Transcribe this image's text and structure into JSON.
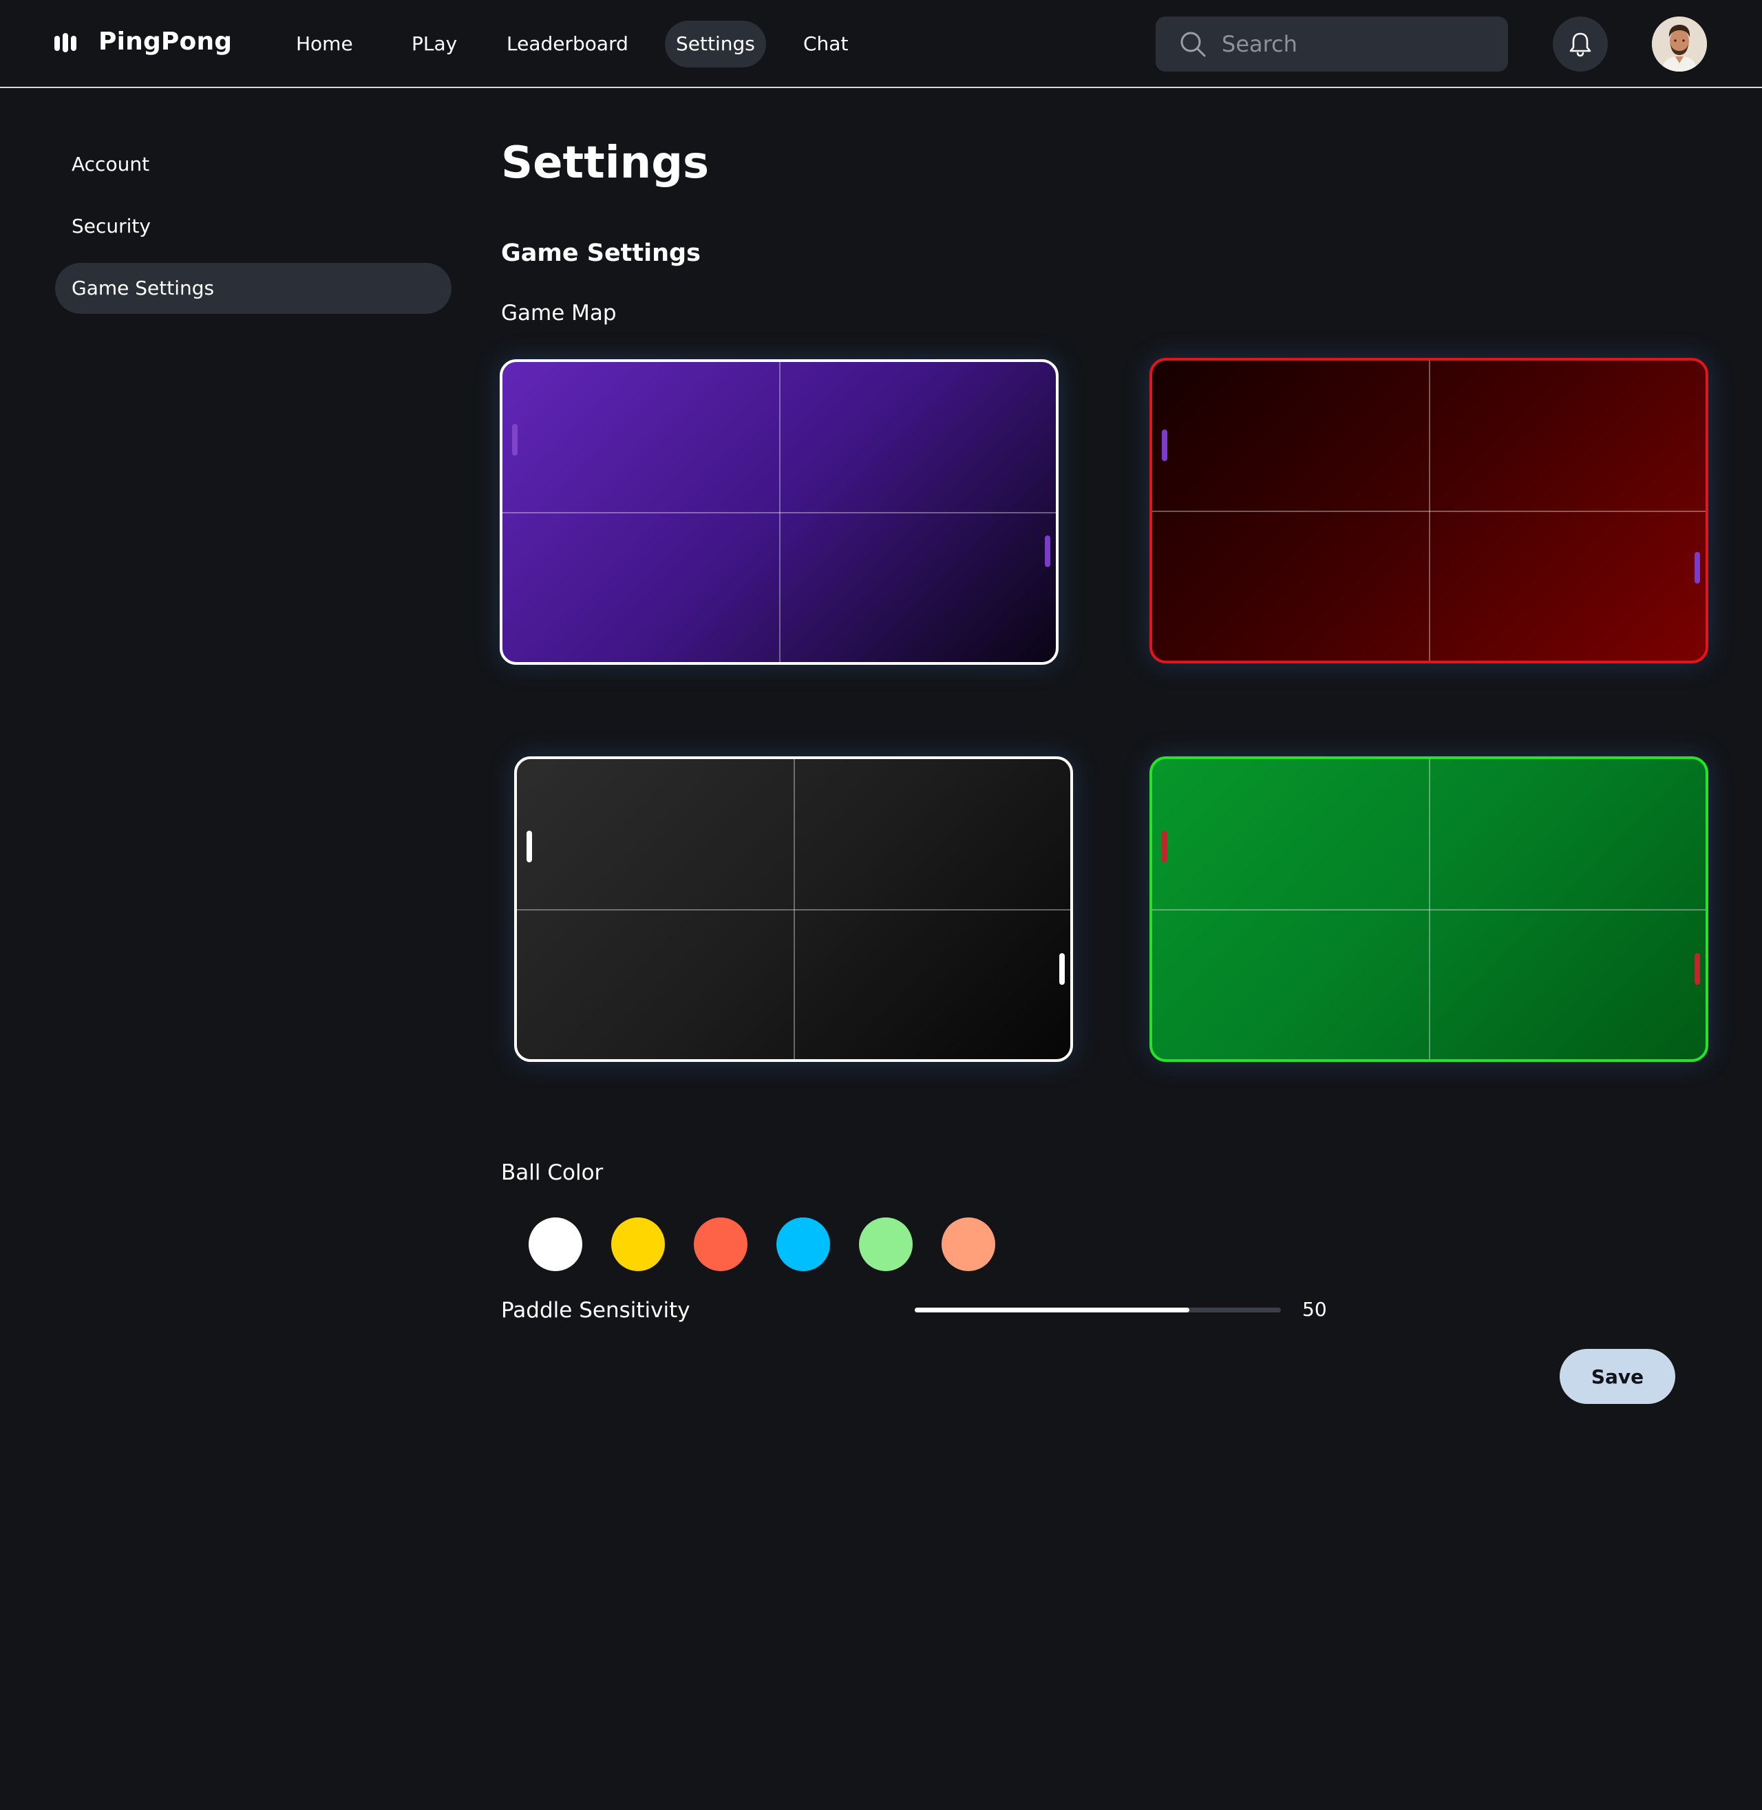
{
  "app": {
    "name": "PingPong"
  },
  "nav": {
    "items": [
      {
        "label": "Home"
      },
      {
        "label": "PLay"
      },
      {
        "label": "Leaderboard"
      },
      {
        "label": "Settings",
        "active": true
      },
      {
        "label": "Chat"
      }
    ]
  },
  "search": {
    "placeholder": "Search",
    "value": ""
  },
  "icons": {
    "logo": "pingpong-logo-icon",
    "search": "search-icon",
    "notifications": "bell-icon",
    "avatar": "user-avatar"
  },
  "sidebar": {
    "items": [
      {
        "label": "Account"
      },
      {
        "label": "Security"
      },
      {
        "label": "Game Settings",
        "active": true
      }
    ]
  },
  "main": {
    "title": "Settings",
    "section_title": "Game Settings",
    "game_map": {
      "label": "Game Map",
      "options": [
        {
          "name": "purple",
          "border": "#ffffff",
          "paddle_color": "#7a3cc9",
          "selected": true
        },
        {
          "name": "red",
          "border": "#e3141b",
          "paddle_color": "#7a3cc9"
        },
        {
          "name": "dark",
          "border": "#ffffff",
          "paddle_color": "#ffffff"
        },
        {
          "name": "green",
          "border": "#26e22b",
          "paddle_color": "#c0272d"
        }
      ]
    },
    "ball_color": {
      "label": "Ball Color",
      "options": [
        "#ffffff",
        "#ffd600",
        "#ff6347",
        "#00bfff",
        "#90ee90",
        "#ffa07a"
      ]
    },
    "paddle_sensitivity": {
      "label": "Paddle Sensitivity",
      "value": "50",
      "fill_fraction": 0.75
    },
    "save_label": "Save"
  }
}
